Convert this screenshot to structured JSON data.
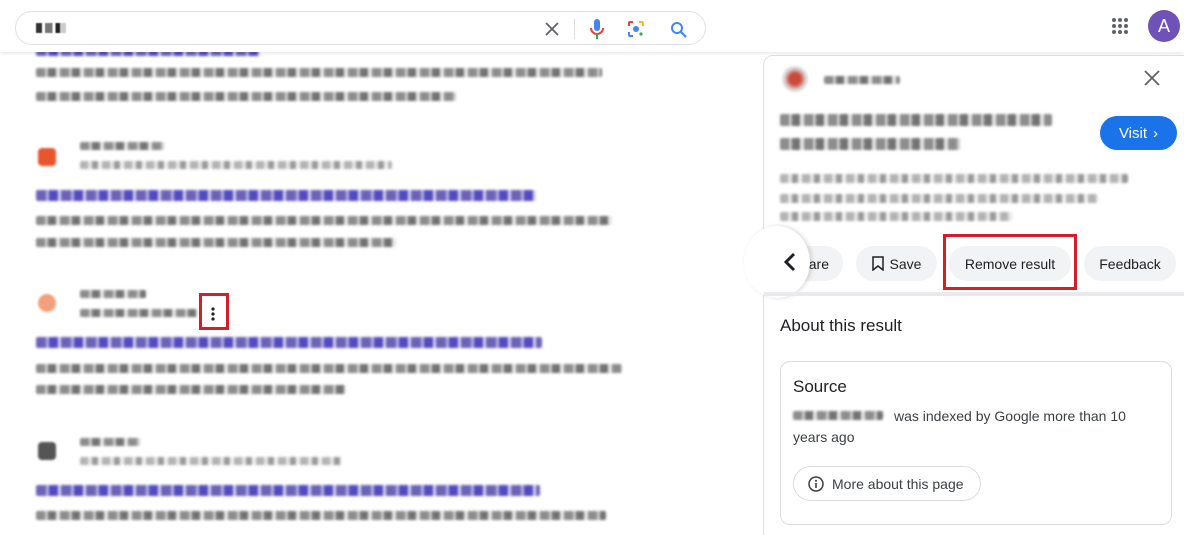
{
  "header": {
    "search_icon": "search-icon",
    "clear_icon": "close-icon",
    "voice_icon": "microphone-icon",
    "lens_icon": "camera-lens-icon",
    "apps_icon": "apps-grid-icon",
    "avatar_letter": "A",
    "avatar_color": "#6f52b5"
  },
  "panel": {
    "close_icon": "close-icon",
    "visit_label": "Visit",
    "visit_color": "#1a73e8",
    "actions": [
      {
        "label": "are"
      },
      {
        "label": "Save"
      },
      {
        "label": "Remove result"
      },
      {
        "label": "Feedback"
      }
    ],
    "about_title": "About this result",
    "source": {
      "heading": "Source",
      "indexed_text_line1": "was indexed by Google more than 10",
      "indexed_text_line2": "years ago",
      "more_label": "More about this page"
    }
  },
  "highlight_color": "#d0202a"
}
